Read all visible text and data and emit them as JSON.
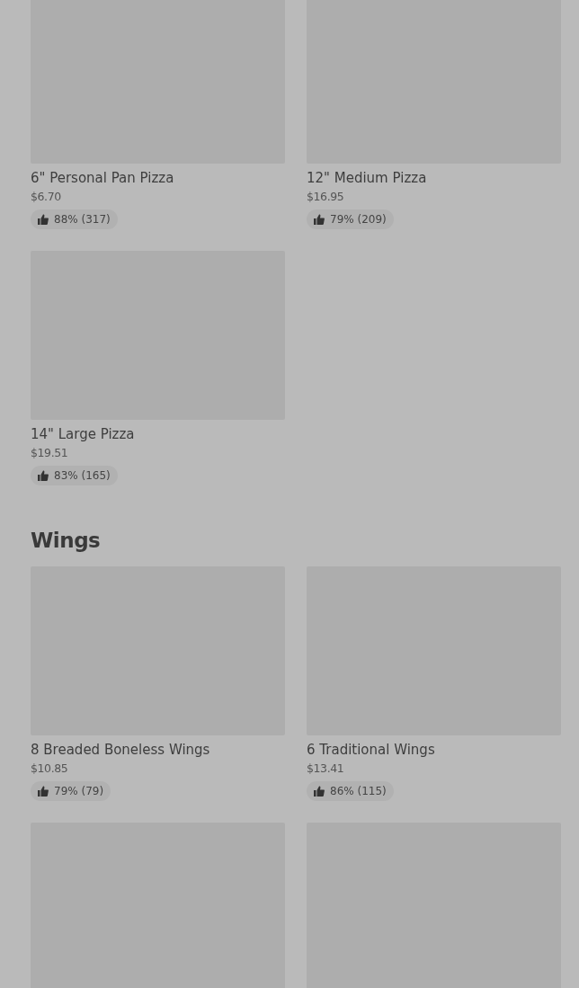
{
  "sections": [
    {
      "items": [
        {
          "kind": "full",
          "name": "6\" Personal Pan Pizza",
          "price": "$6.70",
          "rating": "88% (317)"
        },
        {
          "kind": "full",
          "name": "12\" Medium Pizza",
          "price": "$16.95",
          "rating": "79% (209)"
        },
        {
          "kind": "full",
          "name": "14\" Large Pizza",
          "price": "$19.51",
          "rating": "83% (165)"
        }
      ]
    },
    {
      "title": "Wings",
      "items": [
        {
          "kind": "full",
          "name": "8 Breaded Boneless Wings",
          "price": "$10.85",
          "rating": "79% (79)"
        },
        {
          "kind": "full",
          "name": "6 Traditional Wings",
          "price": "$13.41",
          "rating": "86% (115)"
        },
        {
          "kind": "image"
        },
        {
          "kind": "image"
        }
      ]
    }
  ]
}
